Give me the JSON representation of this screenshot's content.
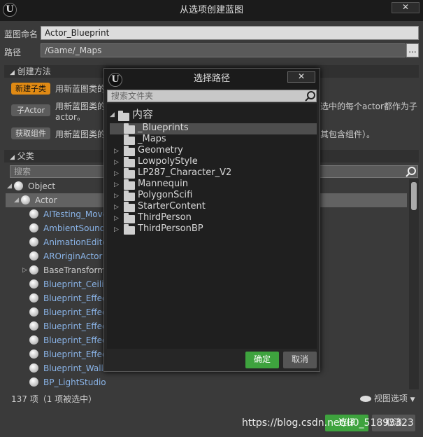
{
  "window": {
    "title": "从选项创建蓝图",
    "close_label": "✕"
  },
  "form": {
    "name_label": "蓝图命名",
    "name_value": "Actor_Blueprint",
    "path_label": "路径",
    "path_value": "/Game/_Maps",
    "browse_label": "..."
  },
  "create_method": {
    "header": "创建方法",
    "options": [
      {
        "button": "新建子类",
        "desc": "用新蓝图类的",
        "desc_right": ""
      },
      {
        "button": "子Actor",
        "desc": "用新蓝图类的",
        "desc_right": "选中的每个actor都作为子",
        "desc2": "actor。"
      },
      {
        "button": "获取组件",
        "desc": "用新蓝图类的",
        "desc_right": "其包含组件）。"
      }
    ]
  },
  "parent_class": {
    "header": "父类",
    "search_placeholder": "搜索",
    "items": [
      {
        "label": "Object",
        "indent": 0,
        "arrow": "◢",
        "selected": false,
        "link": false
      },
      {
        "label": "Actor",
        "indent": 1,
        "arrow": "◢",
        "selected": true,
        "link": false
      },
      {
        "label": "AITesting_Movem",
        "indent": 2,
        "arrow": "",
        "selected": false,
        "link": true
      },
      {
        "label": "AmbientSound (A",
        "indent": 2,
        "arrow": "",
        "selected": false,
        "link": true
      },
      {
        "label": "AnimationEditor",
        "indent": 2,
        "arrow": "",
        "selected": false,
        "link": true
      },
      {
        "label": "AROriginActor (A",
        "indent": 2,
        "arrow": "",
        "selected": false,
        "link": true
      },
      {
        "label": "BaseTransformG",
        "indent": 2,
        "arrow": "▷",
        "selected": false,
        "link": false
      },
      {
        "label": "Blueprint_Ceiling",
        "indent": 2,
        "arrow": "",
        "selected": false,
        "link": true
      },
      {
        "label": "Blueprint_Effect_",
        "indent": 2,
        "arrow": "",
        "selected": false,
        "link": true
      },
      {
        "label": "Blueprint_Effect_",
        "indent": 2,
        "arrow": "",
        "selected": false,
        "link": true
      },
      {
        "label": "Blueprint_Effect_",
        "indent": 2,
        "arrow": "",
        "selected": false,
        "link": true
      },
      {
        "label": "Blueprint_Effect_",
        "indent": 2,
        "arrow": "",
        "selected": false,
        "link": true
      },
      {
        "label": "Blueprint_Effect_",
        "indent": 2,
        "arrow": "",
        "selected": false,
        "link": true
      },
      {
        "label": "Blueprint_WallSc",
        "indent": 2,
        "arrow": "",
        "selected": false,
        "link": true
      },
      {
        "label": "BP_LightStudio",
        "indent": 2,
        "arrow": "",
        "selected": false,
        "link": true
      }
    ],
    "count_text": "137 项（1 项被选中）",
    "view_options": "视图选项"
  },
  "footer": {
    "select_button": "选择",
    "cancel_button": "取消"
  },
  "watermark": "https://blog.csdn.net/u0_51893323",
  "dialog": {
    "title": "选择路径",
    "close_label": "✕",
    "search_placeholder": "搜索文件夹",
    "root": "内容",
    "folders": [
      {
        "name": "_Blueprints",
        "arrow": "",
        "selected": true
      },
      {
        "name": "_Maps",
        "arrow": "",
        "selected": false
      },
      {
        "name": "Geometry",
        "arrow": "▷",
        "selected": false
      },
      {
        "name": "LowpolyStyle",
        "arrow": "▷",
        "selected": false
      },
      {
        "name": "LP287_Character_V2",
        "arrow": "▷",
        "selected": false
      },
      {
        "name": "Mannequin",
        "arrow": "▷",
        "selected": false
      },
      {
        "name": "PolygonScifi",
        "arrow": "▷",
        "selected": false
      },
      {
        "name": "StarterContent",
        "arrow": "▷",
        "selected": false
      },
      {
        "name": "ThirdPerson",
        "arrow": "▷",
        "selected": false
      },
      {
        "name": "ThirdPersonBP",
        "arrow": "▷",
        "selected": false
      }
    ],
    "ok_button": "确定",
    "cancel_button": "取消"
  },
  "colors": {
    "accent_orange": "#e08a14",
    "ok_green": "#3ea33e",
    "link_blue": "#8ab4e8"
  }
}
